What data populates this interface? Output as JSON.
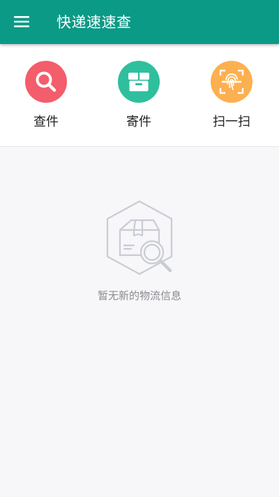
{
  "app": {
    "title": "快递速速查"
  },
  "colors": {
    "primary": "#0b9a86",
    "query": "#f45d6b",
    "send": "#2fbf9d",
    "scan": "#fdb04f",
    "empty_icon": "#c8ccd4"
  },
  "icons": {
    "menu": "hamburger-menu-icon",
    "query": "magnifier-icon",
    "send": "package-box-icon",
    "scan": "fingerprint-scan-icon",
    "empty": "package-search-icon"
  },
  "actions": [
    {
      "label": "查件"
    },
    {
      "label": "寄件"
    },
    {
      "label": "扫一扫"
    }
  ],
  "empty_state": {
    "message": "暂无新的物流信息"
  }
}
